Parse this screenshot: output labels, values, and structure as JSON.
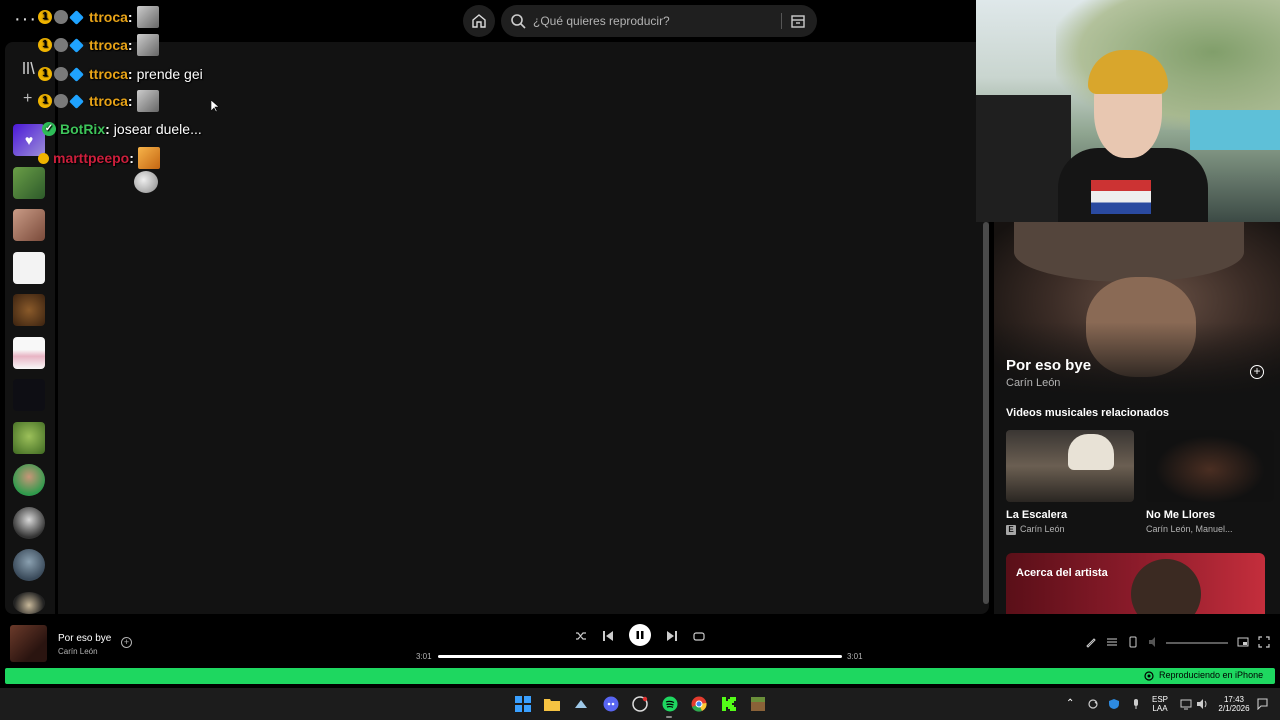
{
  "search": {
    "placeholder": "¿Qué quieres reproducir?"
  },
  "chat": [
    {
      "user": "ttroca",
      "color": "#e8a317",
      "message": "",
      "emote": "image"
    },
    {
      "user": "ttroca",
      "color": "#e8a317",
      "message": "",
      "emote": "image"
    },
    {
      "user": "ttroca",
      "color": "#e8a317",
      "message": "prende gei",
      "emote": ""
    },
    {
      "user": "ttroca",
      "color": "#e8a317",
      "message": "",
      "emote": "image"
    },
    {
      "user": "BotRix",
      "color": "#3ec45a",
      "message": "josear duele...",
      "emote": "face"
    },
    {
      "user": "marttpeepo",
      "color": "#cc1f3c",
      "message": "",
      "emote": "orange"
    }
  ],
  "colon": ":",
  "now_playing_panel": {
    "title": "Por eso bye",
    "artist": "Carín León",
    "related_heading": "Videos musicales relacionados",
    "videos": [
      {
        "title": "La Escalera",
        "artist": "Carín León",
        "explicit": "E"
      },
      {
        "title": "No Me Llores",
        "artist": "Carín León, Manuel..."
      }
    ],
    "about_label": "Acerca del artista"
  },
  "player": {
    "title": "Por eso bye",
    "artist": "Carín León",
    "elapsed": "3:01",
    "duration": "3:01",
    "progress": 1.0
  },
  "device_bar": {
    "label": "Reproduciendo en iPhone"
  },
  "taskbar": {
    "lang_top": "ESP",
    "lang_bottom": "LAA",
    "time": "17:43",
    "date": "2/1/2026"
  },
  "colors": {
    "spotify_green": "#1ed760",
    "panel_bg": "#121212",
    "taskbar_bg": "#1c1c1c"
  }
}
